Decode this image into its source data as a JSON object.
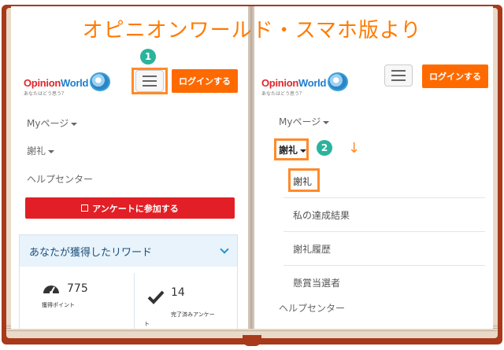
{
  "title": "オピニオンワールド・スマホ版より",
  "logo": {
    "brand_red": "Opinion",
    "brand_blue": "World",
    "tagline": "あなたはどう思う？"
  },
  "left_page": {
    "badge": "1",
    "login_label": "ログインする",
    "nav": {
      "mypage": "Myページ",
      "reward": "謝礼",
      "help": "ヘルプセンター"
    },
    "survey_button": "アンケートに参加する",
    "reward_card": {
      "heading": "あなたが獲得したリワード",
      "points_value": "775",
      "points_label": "獲得ポイント",
      "completed_value": "14",
      "completed_label_1": "完了済みアンケー",
      "completed_label_2": "ト"
    }
  },
  "right_page": {
    "badge": "2",
    "login_label": "ログインする",
    "nav": {
      "mypage": "Myページ",
      "reward": "謝礼",
      "help": "ヘルプセンター"
    },
    "submenu": [
      "謝礼",
      "私の達成結果",
      "謝礼履歴",
      "懸賞当選者"
    ]
  },
  "colors": {
    "accent": "#ff6a00",
    "highlight": "#ff8a2a",
    "survey": "#e21f26",
    "badge": "#2bb39c",
    "cover": "#a8391b"
  },
  "icons": {
    "menu": "hamburger-icon",
    "check": "check-square-icon",
    "gauge": "speedometer-icon",
    "done": "checkmark-icon",
    "expand": "chevron-down-icon"
  }
}
